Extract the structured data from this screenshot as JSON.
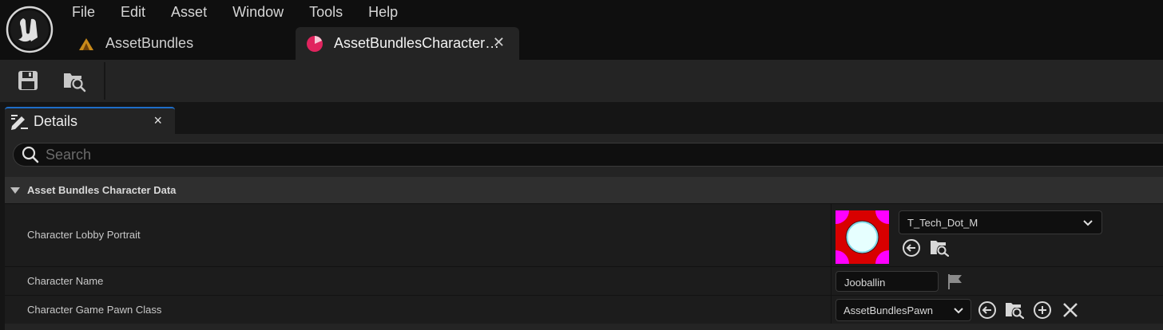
{
  "menu": [
    "File",
    "Edit",
    "Asset",
    "Window",
    "Tools",
    "Help"
  ],
  "tabs": [
    {
      "label": "AssetBundles",
      "icon": "data-asset-icon"
    },
    {
      "label": "AssetBundlesCharacter…",
      "icon": "primary-data-asset-icon",
      "active": true
    }
  ],
  "toolbar": {
    "save_icon": "save-icon",
    "browse_icon": "browse-to-asset-icon"
  },
  "details": {
    "tab_label": "Details",
    "close_glyph": "×",
    "search_placeholder": "Search",
    "category": "Asset Bundles Character Data",
    "properties": [
      {
        "label": "Character Lobby Portrait",
        "value": "T_Tech_Dot_M"
      },
      {
        "label": "Character Name",
        "value": "Jooballin"
      },
      {
        "label": "Character Game Pawn Class",
        "value": "AssetBundlesPawn"
      }
    ]
  },
  "colors": {
    "accent": "#1e6ec8",
    "tab_icon_pink": "#e0245e",
    "thumb_bg": "#d80000",
    "thumb_corner": "#ff00ff",
    "thumb_dot": "#e6ffff"
  }
}
